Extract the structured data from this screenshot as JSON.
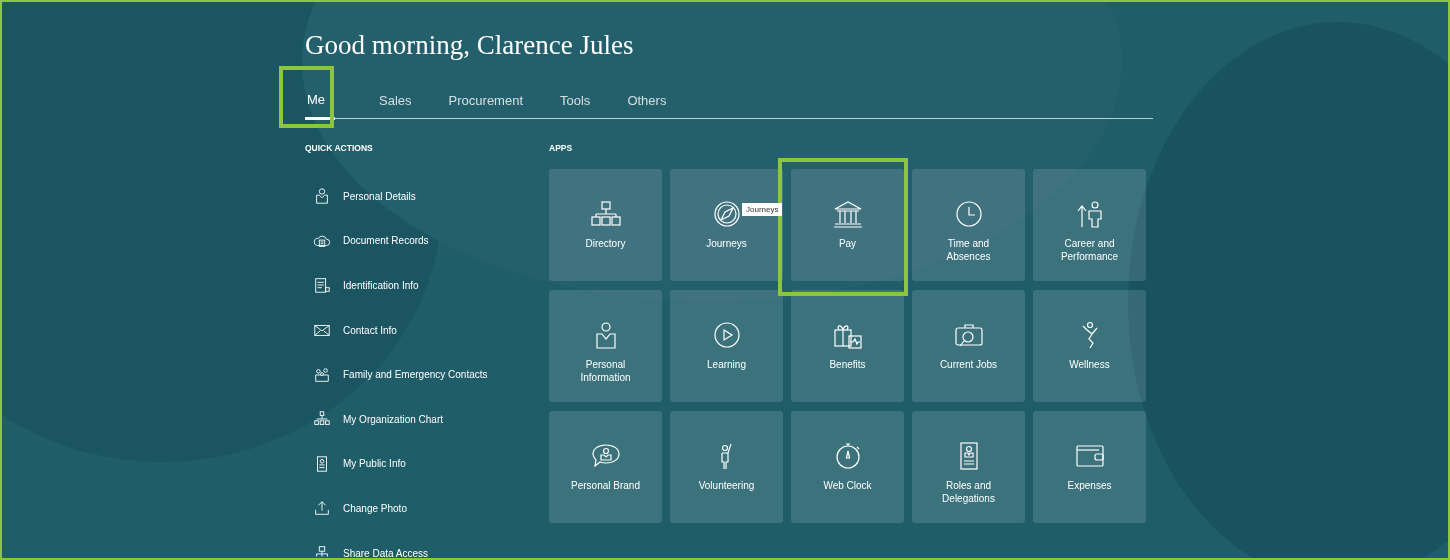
{
  "greeting": "Good morning, Clarence Jules",
  "tabs": [
    {
      "label": "Me",
      "selected": true,
      "highlighted": true
    },
    {
      "label": "Sales",
      "selected": false,
      "highlighted": false
    },
    {
      "label": "Procurement",
      "selected": false,
      "highlighted": false
    },
    {
      "label": "Tools",
      "selected": false,
      "highlighted": false
    },
    {
      "label": "Others",
      "selected": false,
      "highlighted": false
    }
  ],
  "quick_actions": {
    "heading": "QUICK ACTIONS",
    "items": [
      {
        "label": "Personal Details"
      },
      {
        "label": "Document Records"
      },
      {
        "label": "Identification Info"
      },
      {
        "label": "Contact Info"
      },
      {
        "label": "Family and Emergency Contacts"
      },
      {
        "label": "My Organization Chart"
      },
      {
        "label": "My Public Info"
      },
      {
        "label": "Change Photo"
      },
      {
        "label": "Share Data Access"
      }
    ]
  },
  "apps": {
    "heading": "APPS",
    "tiles": [
      {
        "label": "Directory",
        "highlighted": false
      },
      {
        "label": "Journeys",
        "highlighted": false,
        "tooltip": "Journeys"
      },
      {
        "label": "Pay",
        "highlighted": true
      },
      {
        "label": "Time and Absences",
        "highlighted": false
      },
      {
        "label": "Career and Performance",
        "highlighted": false
      },
      {
        "label": "Personal Information",
        "highlighted": false
      },
      {
        "label": "Learning",
        "highlighted": false
      },
      {
        "label": "Benefits",
        "highlighted": false
      },
      {
        "label": "Current Jobs",
        "highlighted": false
      },
      {
        "label": "Wellness",
        "highlighted": false
      },
      {
        "label": "Personal Brand",
        "highlighted": false
      },
      {
        "label": "Volunteering",
        "highlighted": false
      },
      {
        "label": "Web Clock",
        "highlighted": false
      },
      {
        "label": "Roles and Delegations",
        "highlighted": false
      },
      {
        "label": "Expenses",
        "highlighted": false
      }
    ]
  }
}
